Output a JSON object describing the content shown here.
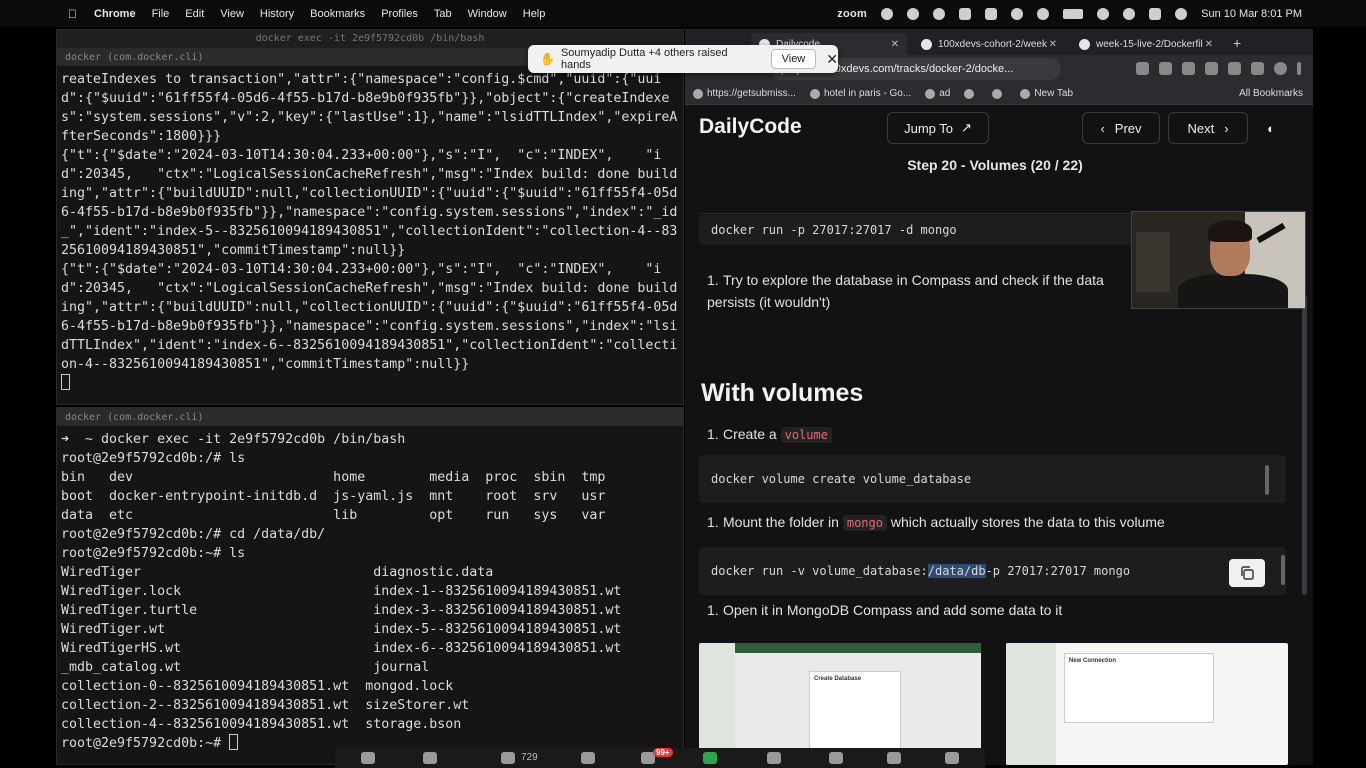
{
  "menubar": {
    "app": "Chrome",
    "items": [
      "File",
      "Edit",
      "View",
      "History",
      "Bookmarks",
      "Profiles",
      "Tab",
      "Window",
      "Help"
    ],
    "zoom": "zoom",
    "datetime": "Sun 10 Mar  8:01 PM"
  },
  "notification": {
    "text": "Soumyadip Dutta +4 others raised hands",
    "view": "View"
  },
  "term_top": {
    "window_title": "docker exec -it 2e9f5792cd0b /bin/bash",
    "tab_title": "docker (com.docker.cli)",
    "lines": [
      "reateIndexes to transaction\",\"attr\":{\"namespace\":\"config.$cmd\",\"uuid\":{\"uuid\":{\"$uuid\":\"61ff55f4-05d6-4f55-b17d-b8e9b0f935fb\"}},\"object\":{\"createIndexes\":\"system.sessions\",\"v\":2,\"key\":{\"lastUse\":1},\"name\":\"lsidTTLIndex\",\"expireAfterSeconds\":1800}}}",
      "{\"t\":{\"$date\":\"2024-03-10T14:30:04.233+00:00\"},\"s\":\"I\",  \"c\":\"INDEX\",    \"id\":20345,   \"ctx\":\"LogicalSessionCacheRefresh\",\"msg\":\"Index build: done building\",\"attr\":{\"buildUUID\":null,\"collectionUUID\":{\"uuid\":{\"$uuid\":\"61ff55f4-05d6-4f55-b17d-b8e9b0f935fb\"}},\"namespace\":\"config.system.sessions\",\"index\":\"_id_\",\"ident\":\"index-5--8325610094189430851\",\"collectionIdent\":\"collection-4--8325610094189430851\",\"commitTimestamp\":null}}",
      "{\"t\":{\"$date\":\"2024-03-10T14:30:04.233+00:00\"},\"s\":\"I\",  \"c\":\"INDEX\",    \"id\":20345,   \"ctx\":\"LogicalSessionCacheRefresh\",\"msg\":\"Index build: done building\",\"attr\":{\"buildUUID\":null,\"collectionUUID\":{\"uuid\":{\"$uuid\":\"61ff55f4-05d6-4f55-b17d-b8e9b0f935fb\"}},\"namespace\":\"config.system.sessions\",\"index\":\"lsidTTLIndex\",\"ident\":\"index-6--8325610094189430851\",\"collectionIdent\":\"collection-4--8325610094189430851\",\"commitTimestamp\":null}}"
    ]
  },
  "term_bottom": {
    "tab_title": "docker (com.docker.cli)",
    "lines": [
      "➜  ~ docker exec -it 2e9f5792cd0b /bin/bash",
      "root@2e9f5792cd0b:/# ls",
      "bin   dev                         home        media  proc  sbin  tmp",
      "boot  docker-entrypoint-initdb.d  js-yaml.js  mnt    root  srv   usr",
      "data  etc                         lib         opt    run   sys   var",
      "root@2e9f5792cd0b:/# cd /data/db/",
      "root@2e9f5792cd0b:~# ls",
      "WiredTiger                             diagnostic.data",
      "WiredTiger.lock                        index-1--8325610094189430851.wt",
      "WiredTiger.turtle                      index-3--8325610094189430851.wt",
      "WiredTiger.wt                          index-5--8325610094189430851.wt",
      "WiredTigerHS.wt                        index-6--8325610094189430851.wt",
      "_mdb_catalog.wt                        journal",
      "collection-0--8325610094189430851.wt  mongod.lock",
      "collection-2--8325610094189430851.wt  sizeStorer.wt",
      "collection-4--8325610094189430851.wt  storage.bson"
    ],
    "prompt": "root@2e9f5792cd0b:~# "
  },
  "browser": {
    "tabs": [
      {
        "label": "Dailycode"
      },
      {
        "label": "100xdevs-cohort-2/week"
      },
      {
        "label": "week-15-live-2/Dockerfil"
      }
    ],
    "url": "projects.100xdevs.com/tracks/docker-2/docke...",
    "bookmarks": [
      "https://getsubmiss...",
      "hotel in paris - Go...",
      "ad",
      "New Tab"
    ],
    "all_bookmarks": "All Bookmarks"
  },
  "page": {
    "brand": "DailyCode",
    "jump_to": "Jump To",
    "prev": "Prev",
    "next": "Next",
    "step": "Step 20 - Volumes (20 / 22)",
    "code1": "docker run -p 27017:27017 -d mongo",
    "item1_num": "1.",
    "item1": "Try to explore the database in Compass and check if the data persists (it wouldn't)",
    "heading": "With volumes",
    "item2_num": "1.",
    "item2_pre": "Create a ",
    "item2_code": "volume",
    "code2": "docker volume create volume_database",
    "item3_num": "1.",
    "item3_pre": "Mount the folder in ",
    "item3_code": "mongo",
    "item3_post": " which actually stores the data to this volume",
    "code3_pre": "docker run -v volume_database:",
    "code3_hl": "/data/db",
    "code3_post": " -p 27017:27017 mongo",
    "item4_num": "1.",
    "item4": "Open it in MongoDB Compass and add some data to it",
    "thumb1_title": "Create Database",
    "thumb2_title": "New Connection"
  },
  "zoombar": {
    "participants": "729",
    "chat_badge": "99+"
  }
}
